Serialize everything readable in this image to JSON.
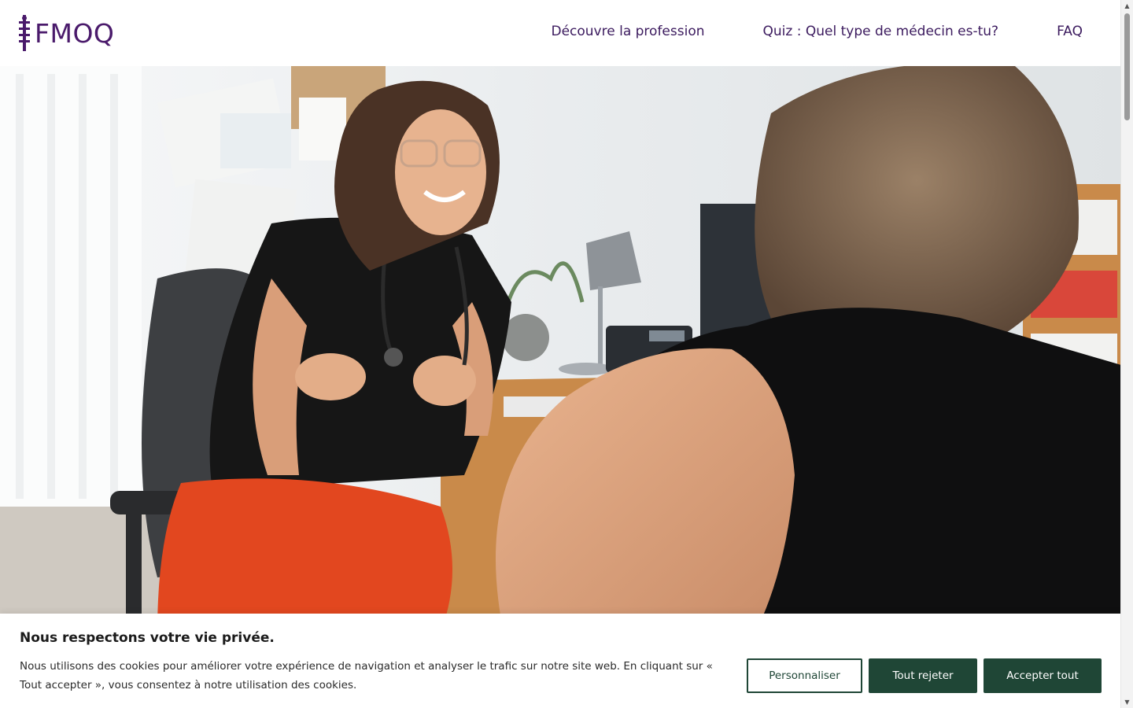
{
  "header": {
    "logo_text": "FMOQ",
    "nav": [
      {
        "label": "Découvre la profession"
      },
      {
        "label": "Quiz : Quel type de médecin es-tu?"
      },
      {
        "label": "FAQ"
      }
    ]
  },
  "colors": {
    "brand_purple": "#4a1a6b",
    "button_green": "#1f4636"
  },
  "cookie_banner": {
    "title": "Nous respectons votre vie privée.",
    "text": "Nous utilisons des cookies pour améliorer votre expérience de navigation et analyser le trafic sur notre site web. En cliquant sur « Tout accepter », vous consentez à notre utilisation des cookies.",
    "buttons": {
      "customize": "Personnaliser",
      "reject": "Tout rejeter",
      "accept": "Accepter tout"
    }
  }
}
